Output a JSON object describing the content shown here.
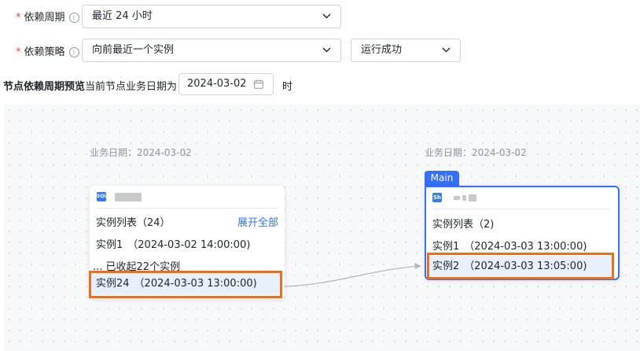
{
  "form": {
    "cycle": {
      "required": "*",
      "label": "依赖周期",
      "info": "i",
      "value": "最近 24 小时"
    },
    "strategy": {
      "required": "*",
      "label": "依赖策略",
      "info": "i",
      "value": "向前最近一个实例",
      "status_value": "运行成功"
    },
    "preview": {
      "label": "节点依赖周期预览",
      "date_prefix": "当前节点业务日期为",
      "date_value": "2024-03-02",
      "suffix": "时"
    }
  },
  "graph": {
    "left": {
      "date_label": "业务日期：2024-03-02",
      "type_icon": "SQL",
      "list_title": "实例列表（24）",
      "expand_label": "展开全部",
      "instances": [
        {
          "name": "实例1",
          "time": "（2024-03-02 14:00:00)"
        }
      ],
      "collapsed_text": "... 已收起22个实例",
      "selected_instance": {
        "name": "实例24",
        "time": "（2024-03-03 13:00:00)"
      }
    },
    "right": {
      "tag": "Main",
      "date_label": "业务日期：2024-03-02",
      "type_icon": "Sh",
      "list_title": "实例列表（2)",
      "instances": [
        {
          "name": "实例1",
          "time": "（2024-03-03 13:00:00)"
        }
      ],
      "selected_instance": {
        "name": "实例2",
        "time": "（2024-03-03 13:05:00)"
      }
    }
  },
  "colors": {
    "accent": "#3370ff",
    "highlight_box": "#e8701a",
    "selected_row": "#e8f0fd",
    "required": "#f54a45"
  },
  "icons": {
    "info": "info-circle-icon",
    "chevron": "chevron-down-icon",
    "calendar": "calendar-icon"
  }
}
